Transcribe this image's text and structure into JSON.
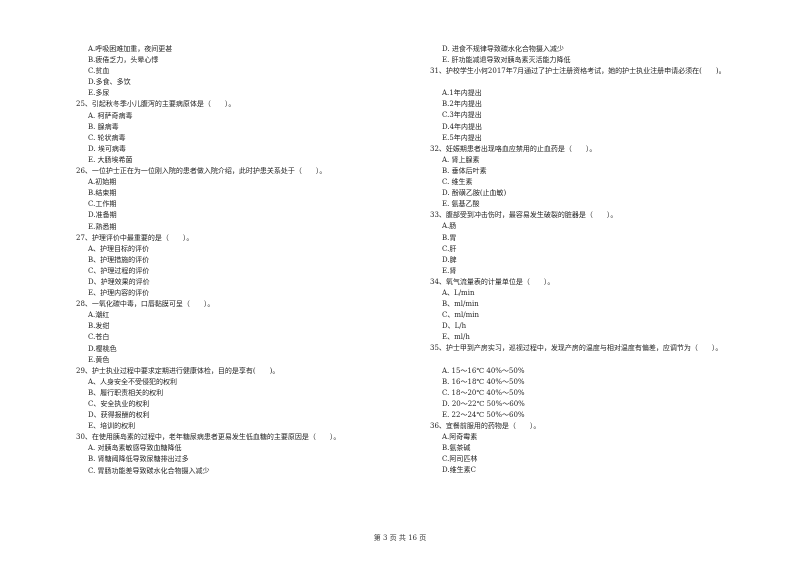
{
  "left_column": [
    {
      "type": "opt",
      "text": "A.呼吸困难加重，夜间更甚"
    },
    {
      "type": "opt",
      "text": "B.疲倦乏力，头晕心悸"
    },
    {
      "type": "opt",
      "text": "C.贫血"
    },
    {
      "type": "opt",
      "text": "D.多食、多饮"
    },
    {
      "type": "opt",
      "text": "E.多尿"
    },
    {
      "type": "q",
      "text": "25、引起秋冬季小儿腹泻的主要病原体是（　　）。"
    },
    {
      "type": "opt",
      "text": "A. 柯萨奇病毒"
    },
    {
      "type": "opt",
      "text": "B. 腺病毒"
    },
    {
      "type": "opt",
      "text": "C. 轮状病毒"
    },
    {
      "type": "opt",
      "text": "D. 埃可病毒"
    },
    {
      "type": "opt",
      "text": "E. 大肠埃希菌"
    },
    {
      "type": "q",
      "text": "26、一位护士正在为一位刚入院的患者做入院介绍，此时护患关系处于（　　）。"
    },
    {
      "type": "opt",
      "text": "A.初始期"
    },
    {
      "type": "opt",
      "text": "B.结束期"
    },
    {
      "type": "opt",
      "text": "C.工作期"
    },
    {
      "type": "opt",
      "text": "D.准备期"
    },
    {
      "type": "opt",
      "text": "E.熟悉期"
    },
    {
      "type": "q",
      "text": "27、护理评价中最重要的是（　　）。"
    },
    {
      "type": "opt",
      "text": "A、护理目标的评价"
    },
    {
      "type": "opt",
      "text": "B、护理措施的评价"
    },
    {
      "type": "opt",
      "text": "C、护理过程的评价"
    },
    {
      "type": "opt",
      "text": "D、护理效果的评价"
    },
    {
      "type": "opt",
      "text": "E、护理内容的评价"
    },
    {
      "type": "q",
      "text": "28、一氧化碳中毒，口唇黏膜可呈（　　）。"
    },
    {
      "type": "opt",
      "text": "A.潮红"
    },
    {
      "type": "opt",
      "text": "B.发绀"
    },
    {
      "type": "opt",
      "text": "C.苍白"
    },
    {
      "type": "opt",
      "text": "D.樱桃色"
    },
    {
      "type": "opt",
      "text": "E.黄色"
    },
    {
      "type": "q",
      "text": "29、护士执业过程中要求定期进行健康体检，目的是享有(　　)。"
    },
    {
      "type": "opt",
      "text": "A、人身安全不受侵犯的权利"
    },
    {
      "type": "opt",
      "text": "B、履行职责相关的权利"
    },
    {
      "type": "opt",
      "text": "C、安全执业的权利"
    },
    {
      "type": "opt",
      "text": "D、获得报酬的权利"
    },
    {
      "type": "opt",
      "text": "E、培训的权利"
    },
    {
      "type": "q",
      "text": "30、在使用胰岛素的过程中，老年糖尿病患者更易发生低血糖的主要原因是（　　）。"
    },
    {
      "type": "opt",
      "text": "A. 对胰岛素敏感导致血糖降低"
    },
    {
      "type": "opt",
      "text": "B. 肾糖阈降低导致尿糖排出过多"
    },
    {
      "type": "opt",
      "text": "C. 胃肠功能差导致碳水化合物摄入减少"
    }
  ],
  "right_column": [
    {
      "type": "opt",
      "text": "D. 进食不规律导致碳水化合物摄入减少"
    },
    {
      "type": "opt",
      "text": "E. 肝功能减退导致对胰岛素灭活能力降低"
    },
    {
      "type": "q",
      "text": "31、护校学生小何2017年7月通过了护士注册资格考试，她的护士执业注册申请必须在(　　)。"
    },
    {
      "type": "gap",
      "text": ""
    },
    {
      "type": "opt",
      "text": "A.1年内提出"
    },
    {
      "type": "opt",
      "text": "B.2年内提出"
    },
    {
      "type": "opt",
      "text": "C.3年内提出"
    },
    {
      "type": "opt",
      "text": "D.4年内提出"
    },
    {
      "type": "opt",
      "text": "E.5年内提出"
    },
    {
      "type": "q",
      "text": "32、妊娠期患者出现咯血应禁用的止血药是（　　）。"
    },
    {
      "type": "opt",
      "text": "A. 肾上腺素"
    },
    {
      "type": "opt",
      "text": "B. 垂体后叶素"
    },
    {
      "type": "opt",
      "text": "C. 维生素"
    },
    {
      "type": "opt",
      "text": "D. 酚磺乙胺(止血敏)"
    },
    {
      "type": "opt",
      "text": "E. 氨基乙酸"
    },
    {
      "type": "q",
      "text": "33、腹部受到冲击伤时，最容易发生破裂的脏器是（　　）。"
    },
    {
      "type": "opt",
      "text": "A.肠"
    },
    {
      "type": "opt",
      "text": "B.胃"
    },
    {
      "type": "opt",
      "text": "C.肝"
    },
    {
      "type": "opt",
      "text": "D.脾"
    },
    {
      "type": "opt",
      "text": "E.肾"
    },
    {
      "type": "q",
      "text": "34、氧气流量表的计量单位是（　　）。"
    },
    {
      "type": "opt",
      "text": "A、L/min"
    },
    {
      "type": "opt",
      "text": "B、ml/min"
    },
    {
      "type": "opt",
      "text": "C、ml/min"
    },
    {
      "type": "opt",
      "text": "D、L/h"
    },
    {
      "type": "opt",
      "text": "E、ml/h"
    },
    {
      "type": "q",
      "text": "35、护士甲到产房实习，巡视过程中，发现产房的温度与相对温度有偏差，应调节为（　　）。"
    },
    {
      "type": "gap",
      "text": ""
    },
    {
      "type": "opt",
      "text": "A. 15～16℃ 40%～50%"
    },
    {
      "type": "opt",
      "text": "B. 16～18℃ 40%～50%"
    },
    {
      "type": "opt",
      "text": "C. 18～20℃ 40%～50%"
    },
    {
      "type": "opt",
      "text": "D. 20～22℃ 50%～60%"
    },
    {
      "type": "opt",
      "text": "E. 22～24℃ 50%～60%"
    },
    {
      "type": "q",
      "text": "36、宜餐前服用的药物是（　　）。"
    },
    {
      "type": "opt",
      "text": "A.阿奇霉素"
    },
    {
      "type": "opt",
      "text": "B.氨茶碱"
    },
    {
      "type": "opt",
      "text": "C.阿司匹林"
    },
    {
      "type": "opt",
      "text": "D.维生素C"
    }
  ],
  "footer": {
    "page_label": "第 3 页 共 16 页"
  }
}
